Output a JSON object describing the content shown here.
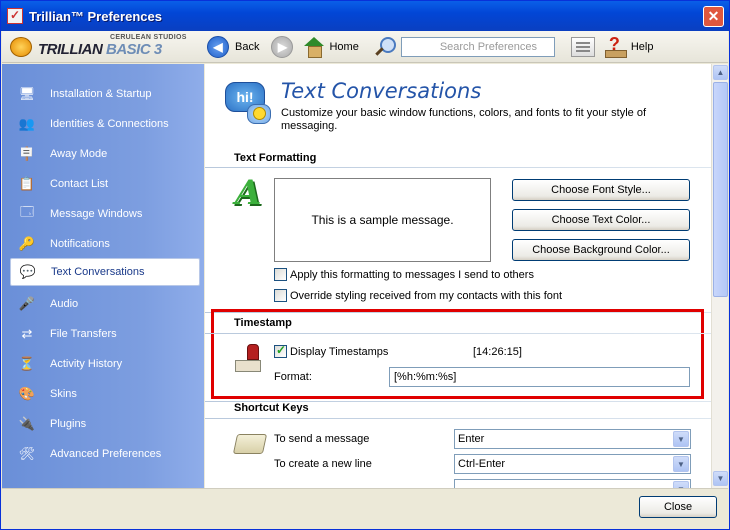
{
  "window": {
    "title": "Trillian™ Preferences"
  },
  "toolbar": {
    "logo_top": "CERULEAN STUDIOS",
    "logo_brand": "TRILLIAN",
    "logo_edition": "BASIC 3",
    "back_label": "Back",
    "home_label": "Home",
    "search_placeholder": "Search Preferences",
    "help_label": "Help"
  },
  "sidebar": {
    "items": [
      {
        "label": "Installation & Startup",
        "icon": "monitor-icon"
      },
      {
        "label": "Identities & Connections",
        "icon": "people-icon"
      },
      {
        "label": "Away Mode",
        "icon": "away-sign-icon"
      },
      {
        "label": "Contact List",
        "icon": "contact-list-icon"
      },
      {
        "label": "Message Windows",
        "icon": "message-window-icon"
      },
      {
        "label": "Notifications",
        "icon": "notification-key-icon"
      },
      {
        "label": "Text Conversations",
        "icon": "chat-bubble-icon",
        "active": true
      },
      {
        "label": "Audio",
        "icon": "microphone-icon"
      },
      {
        "label": "File Transfers",
        "icon": "file-transfer-icon"
      },
      {
        "label": "Activity History",
        "icon": "history-icon"
      },
      {
        "label": "Skins",
        "icon": "skins-palette-icon"
      },
      {
        "label": "Plugins",
        "icon": "plugin-icon"
      },
      {
        "label": "Advanced Preferences",
        "icon": "advanced-tools-icon"
      }
    ]
  },
  "main": {
    "icon_text": "hi!",
    "title": "Text Conversations",
    "description": "Customize your basic window functions, colors, and fonts to fit your style of messaging.",
    "text_formatting": {
      "heading": "Text Formatting",
      "sample": "This is a sample message.",
      "buttons": {
        "font": "Choose Font Style...",
        "color": "Choose Text Color...",
        "background": "Choose Background Color..."
      },
      "apply_label": "Apply this formatting to messages I send to others",
      "override_label": "Override styling received from my contacts with this font"
    },
    "timestamp": {
      "heading": "Timestamp",
      "display_label": "Display Timestamps",
      "display_checked": true,
      "preview": "[14:26:15]",
      "format_label": "Format:",
      "format_value": "[%h:%m:%s]"
    },
    "shortcuts": {
      "heading": "Shortcut Keys",
      "send_label": "To send a message",
      "send_value": "Enter",
      "newline_label": "To create a new line",
      "newline_value": "Ctrl-Enter"
    }
  },
  "footer": {
    "close_label": "Close"
  },
  "colors": {
    "highlight": "#e00000",
    "title_blue": "#2454a8",
    "sidebar": "#7d9ee0"
  }
}
